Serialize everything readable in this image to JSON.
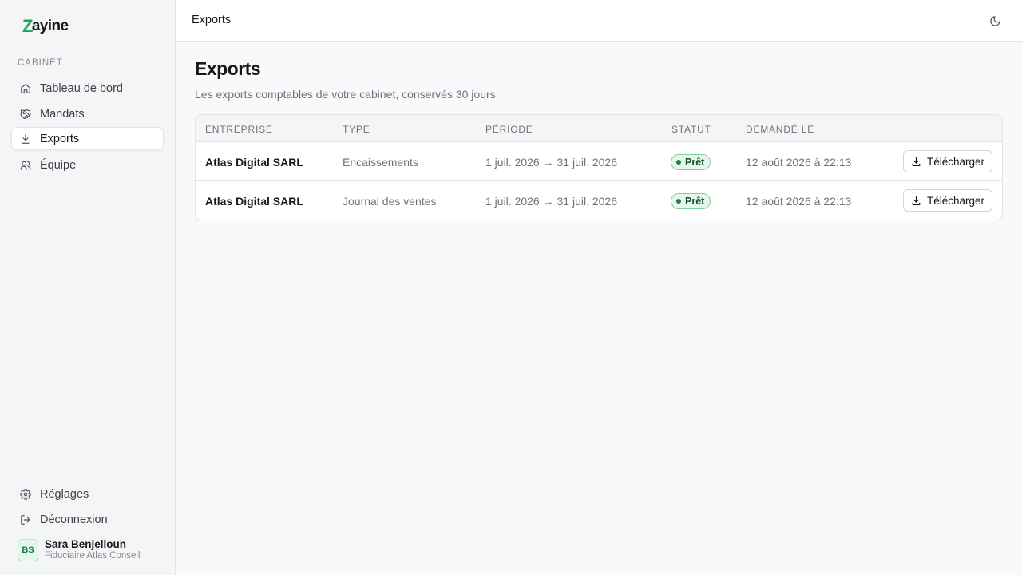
{
  "app": {
    "logo_text": "ayine",
    "logo_mark": "Z"
  },
  "sidebar": {
    "section_label": "CABINET",
    "items": [
      {
        "label": "Tableau de bord",
        "icon": "home-icon",
        "active": false
      },
      {
        "label": "Mandats",
        "icon": "handshake-icon",
        "active": false
      },
      {
        "label": "Exports",
        "icon": "download-icon",
        "active": true
      },
      {
        "label": "Équipe",
        "icon": "users-icon",
        "active": false
      }
    ],
    "footer_items": [
      {
        "label": "Réglages",
        "icon": "gear-icon"
      },
      {
        "label": "Déconnexion",
        "icon": "logout-icon"
      }
    ],
    "user": {
      "initials": "BS",
      "name": "Sara Benjelloun",
      "org": "Fiduciaire Atlas Conseil"
    }
  },
  "topbar": {
    "title": "Exports",
    "theme_icon": "moon-icon"
  },
  "main": {
    "title": "Exports",
    "subtitle": "Les exports comptables de votre cabinet, conservés 30 jours",
    "table": {
      "columns": [
        "ENTREPRISE",
        "TYPE",
        "PÉRIODE",
        "STATUT",
        "DEMANDÉ LE"
      ],
      "rows": [
        {
          "company": "Atlas Digital SARL",
          "type": "Encaissements",
          "period": "1 juil. 2026 → 31 juil. 2026",
          "status": "Prêt",
          "requested": "12 août 2026 à 22:13",
          "action": "Télécharger"
        },
        {
          "company": "Atlas Digital SARL",
          "type": "Journal des ventes",
          "period": "1 juil. 2026 → 31 juil. 2026",
          "status": "Prêt",
          "requested": "12 août 2026 à 22:13",
          "action": "Télécharger"
        }
      ]
    }
  },
  "colors": {
    "accent": "#22a55b",
    "status_ready_bg": "#e7f6ec",
    "status_ready_text": "#14532d"
  }
}
